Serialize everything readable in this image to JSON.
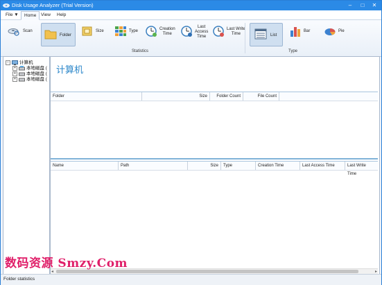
{
  "window": {
    "title": "Disk Usage Analyzer (Trial Version)",
    "controls": {
      "minimize": "–",
      "maximize": "□",
      "close": "✕"
    }
  },
  "menu": {
    "file": "File ▼",
    "home": "Home",
    "view": "View",
    "help": "Help"
  },
  "ribbon": {
    "scan": "Scan",
    "folder": "Folder",
    "size": "Size",
    "type": "Type",
    "creation_time": [
      "Creation",
      "Time"
    ],
    "last_access_time": [
      "Last",
      "Access",
      "Time"
    ],
    "last_write_time": [
      "Last Write",
      "Time"
    ],
    "list": "List",
    "bar": "Bar",
    "pie": "Pie",
    "group_statistics": "Statistics",
    "group_type": "Type"
  },
  "tree": {
    "root": "计算机",
    "drives": [
      "本地磁盘 (",
      "本地磁盘 (",
      "本地磁盘 ("
    ]
  },
  "main": {
    "heading": "计算机",
    "grid1_columns": [
      "Folder",
      "Size",
      "Folder Count",
      "File Count"
    ],
    "grid2_columns": [
      "Name",
      "Path",
      "Size",
      "Type",
      "Creation Time",
      "Last Access Time",
      "Last Write Time"
    ]
  },
  "status": {
    "text": "Folder statistics"
  },
  "watermark": "数码资源 Smzy.Com"
}
